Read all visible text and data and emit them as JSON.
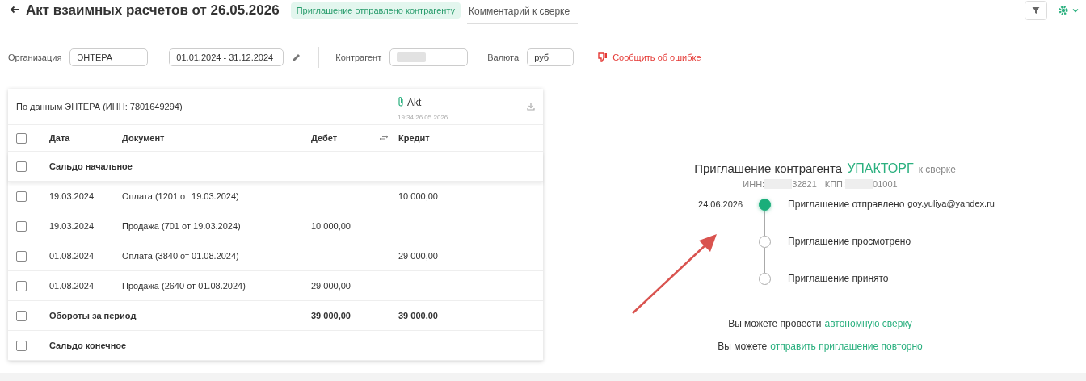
{
  "title": "Акт взаимных расчетов от 26.05.2026",
  "status_badge": "Приглашение отправлено контрагенту",
  "comment_tab": "Комментарий к сверке",
  "filters": {
    "organization": {
      "label": "Организация",
      "value": "ЭНТЕРА"
    },
    "period": "01.01.2024 - 31.12.2024",
    "contractor": {
      "label": "Контрагент"
    },
    "currency": {
      "label": "Валюта",
      "value": "руб"
    },
    "report_error": "Сообщить об ошибке"
  },
  "table": {
    "header_checked": false,
    "source": "По данным ЭНТЕРА (ИНН: 7801649294)",
    "attachment": {
      "name": "Akt",
      "time": "19:34 26.05.2026"
    },
    "columns": [
      "Дата",
      "Документ",
      "Дебет",
      "Кредит"
    ],
    "rows": [
      {
        "kind": "summary",
        "checked": false,
        "label": "Сальдо начальное"
      },
      {
        "kind": "entry",
        "checked": false,
        "date": "19.03.2024",
        "document": "Оплата (1201 от 19.03.2024)",
        "credit": "10 000,00"
      },
      {
        "kind": "entry",
        "checked": false,
        "date": "19.03.2024",
        "document": "Продажа (701 от 19.03.2024)",
        "debit": "10 000,00"
      },
      {
        "kind": "entry",
        "checked": false,
        "date": "01.08.2024",
        "document": "Оплата (3840 от 01.08.2024)",
        "credit": "29 000,00"
      },
      {
        "kind": "entry",
        "checked": false,
        "date": "01.08.2024",
        "document": "Продажа (2640 от 01.08.2024)",
        "debit": "29 000,00"
      },
      {
        "kind": "summary",
        "checked": false,
        "label": "Обороты за период",
        "debit": "39 000,00",
        "credit": "39 000,00"
      },
      {
        "kind": "summary",
        "checked": false,
        "label": "Сальдо конечное"
      }
    ]
  },
  "invitation": {
    "title": "Приглашение контрагента",
    "company": "УПАКТОРГ",
    "suffix": "к сверке",
    "inn_label": "ИНН:",
    "inn_tail": "32821",
    "kpp_label": "КПП:",
    "kpp_tail": "01001",
    "steps": [
      {
        "date": "24.06.2026",
        "text": "Приглашение отправлено",
        "email": "goy.yuliya@yandex.ru",
        "done": true
      },
      {
        "text": "Приглашение просмотрено",
        "done": false
      },
      {
        "text": "Приглашение принято",
        "done": false
      }
    ],
    "notes": [
      {
        "text": "Вы можете провести",
        "link": "автономную сверку"
      },
      {
        "text": "Вы можете",
        "link": "отправить приглашение повторно"
      }
    ]
  }
}
